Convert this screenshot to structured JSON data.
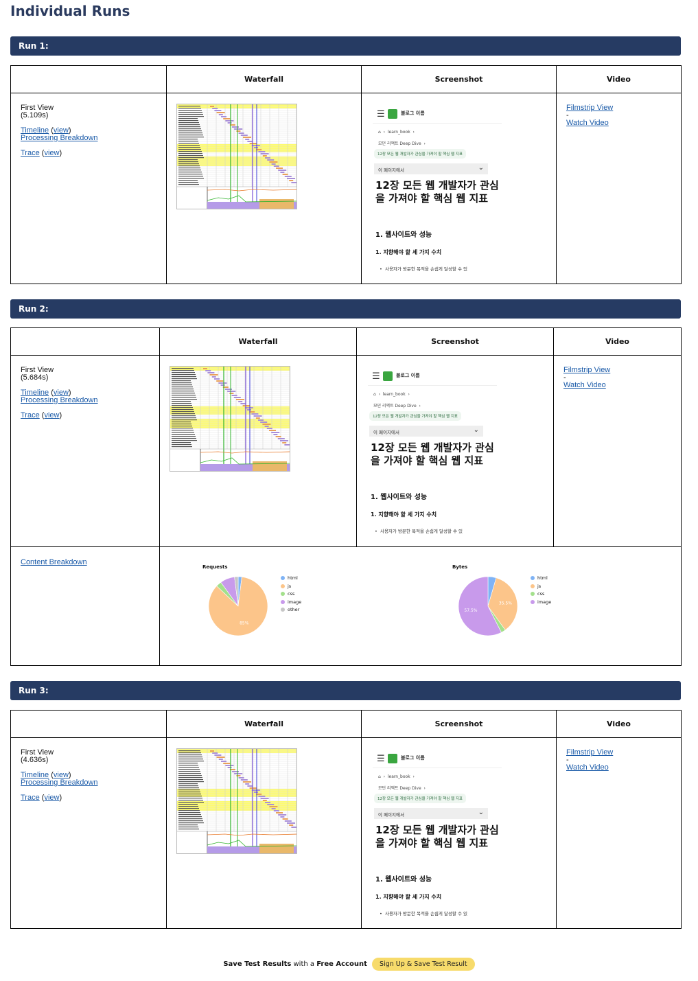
{
  "page_title": "Individual Runs",
  "table_headers": {
    "waterfall": "Waterfall",
    "screenshot": "Screenshot",
    "video": "Video"
  },
  "runs": [
    {
      "title": "Run 1:",
      "view_label": "First View",
      "time": "(5.109s)",
      "timeline": "Timeline",
      "view": "view",
      "processing": "Processing Breakdown",
      "trace": "Trace",
      "filmstrip": "Filmstrip View",
      "dash": "-",
      "watch": "Watch Video"
    },
    {
      "title": "Run 2:",
      "view_label": "First View",
      "time": "(5.684s)",
      "timeline": "Timeline",
      "view": "view",
      "processing": "Processing Breakdown",
      "trace": "Trace",
      "filmstrip": "Filmstrip View",
      "dash": "-",
      "watch": "Watch Video",
      "content_breakdown": "Content Breakdown"
    },
    {
      "title": "Run 3:",
      "view_label": "First View",
      "time": "(4.636s)",
      "timeline": "Timeline",
      "view": "view",
      "processing": "Processing Breakdown",
      "trace": "Trace",
      "filmstrip": "Filmstrip View",
      "dash": "-",
      "watch": "Watch Video"
    }
  ],
  "screenshot": {
    "menu_icon": "hamburger-icon",
    "blog_name": "블로그 이름",
    "crumb_home": "learn_book",
    "crumb_sub": "모던 리액트 Deep Dive",
    "tag": "12장 모든 웹 개발자가 관심을 가져야 할 핵심 웹 지표",
    "toc": "이 페이지에서",
    "heading": "12장 모든 웹 개발자가 관심을 가져야 할 핵심 웹 지표",
    "h2": "1. 웹사이트와 성능",
    "h3": "1. 지향해야 할 세 가지 수치",
    "li": "사용자가 방문한 목적을 손쉽게 달성할 수 있"
  },
  "chart_data": [
    {
      "type": "pie",
      "title": "Requests",
      "categories": [
        "html",
        "js",
        "css",
        "image",
        "other"
      ],
      "values": [
        2,
        85,
        3,
        8,
        2
      ],
      "colors": [
        "#7fb3f5",
        "#fcc58a",
        "#a3e08c",
        "#c89aeb",
        "#c6c6c6"
      ],
      "labels": [
        "",
        "85%",
        "",
        "",
        ""
      ]
    },
    {
      "type": "pie",
      "title": "Bytes",
      "categories": [
        "html",
        "js",
        "css",
        "image"
      ],
      "values": [
        4.5,
        35.5,
        2.5,
        57.5
      ],
      "colors": [
        "#7fb3f5",
        "#fcc58a",
        "#a3e08c",
        "#c89aeb"
      ],
      "labels": [
        "",
        "35.5%",
        "",
        "57.5%"
      ]
    }
  ],
  "footer": {
    "save": "Save Test Results",
    "with": "with a",
    "free": "Free Account",
    "button": "Sign Up & Save Test Result"
  }
}
